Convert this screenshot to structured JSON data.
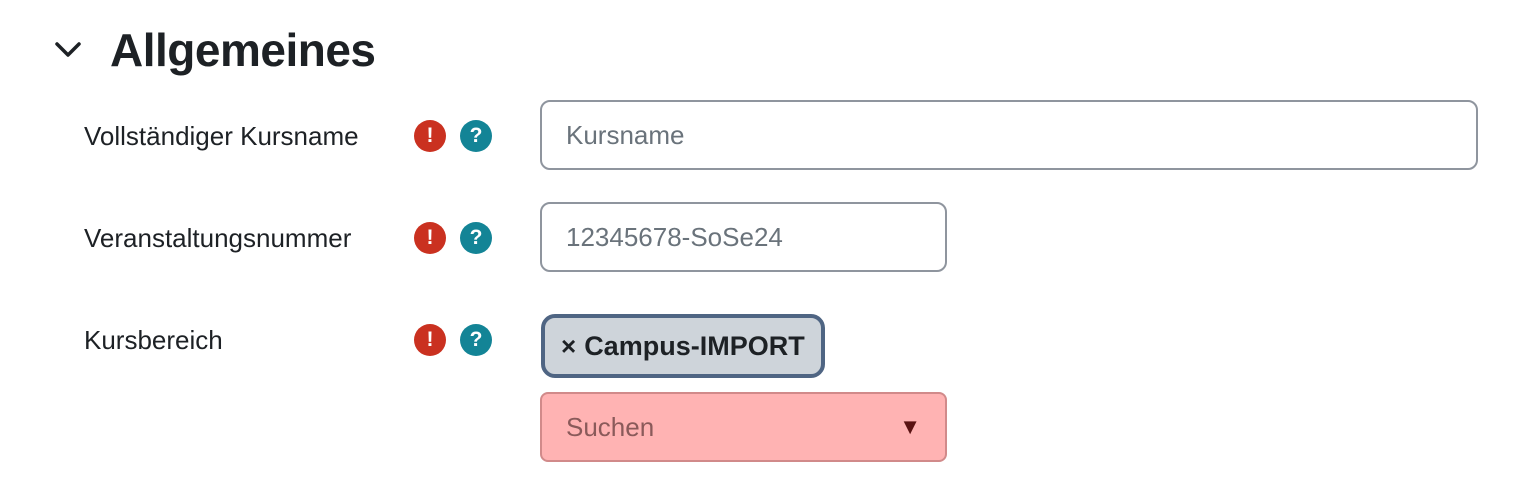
{
  "section": {
    "title": "Allgemeines",
    "toggle_icon": "chevron-down-icon"
  },
  "fields": {
    "fullname": {
      "label": "Vollständiger Kursname",
      "placeholder": "Kursname",
      "value": "",
      "required_icon": "exclamation-icon",
      "help_icon": "question-icon"
    },
    "idnumber": {
      "label": "Veranstaltungsnummer",
      "placeholder": "12345678-SoSe24",
      "value": "",
      "required_icon": "exclamation-icon",
      "help_icon": "question-icon"
    },
    "category": {
      "label": "Kursbereich",
      "selected": {
        "remove_symbol": "×",
        "label": "Campus-IMPORT"
      },
      "search_placeholder": "Suchen",
      "dropdown_symbol": "▼",
      "required_icon": "exclamation-icon",
      "help_icon": "question-icon"
    }
  },
  "icons": {
    "required_glyph": "!",
    "help_glyph": "?"
  },
  "colors": {
    "required": "#ca3120",
    "help": "#138496",
    "badge_bg": "#ced4da",
    "badge_border": "#4f6583",
    "search_error_bg": "#ffb3b3"
  }
}
